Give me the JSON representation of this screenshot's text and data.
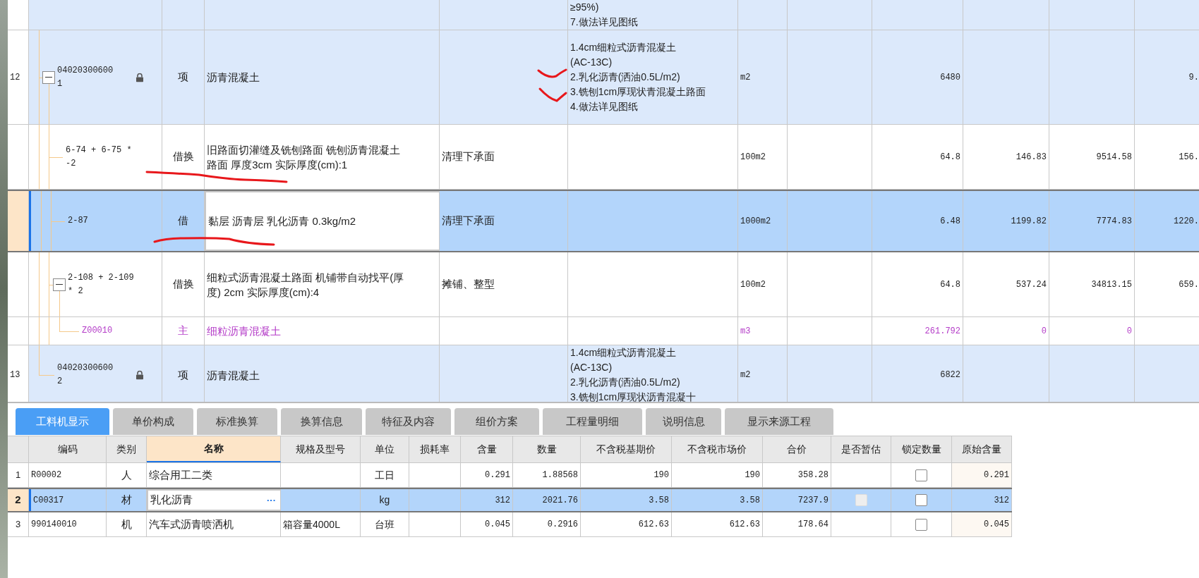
{
  "grid": {
    "rows": [
      {
        "kind": "item",
        "selected": false,
        "features": [
          "≥95%)",
          "7.做法详见图纸"
        ]
      },
      {
        "kind": "item",
        "selected": false,
        "number": "12",
        "code": "040203006001",
        "locked": true,
        "expanded": true,
        "type": "项",
        "name": "沥青混凝土",
        "features": [
          "1.4cm细粒式沥青混凝土",
          "(AC-13C)",
          "2.乳化沥青(洒油0.5L/m2)",
          "3.铣刨1cm厚现状青混凝土路面",
          "4.做法详见图纸"
        ],
        "unit": "m2",
        "column_9": "6480",
        "column_12": "9.",
        "children": [
          {
            "kind": "sub",
            "selected": false,
            "code": "6-74 + 6-75 * -2",
            "type": "借换",
            "name": "旧路面切灌缝及铣刨路面 铣刨沥青混凝土路面 厚度3cm  实际厚度(cm):1",
            "column_5": "清理下承面",
            "unit": "100m2",
            "column_9": "64.8",
            "column_10": "146.83",
            "column_11": "9514.58",
            "column_12": "156."
          },
          {
            "kind": "sub",
            "selected": true,
            "code": "2-87",
            "type": "借",
            "name": "黏层 沥青层 乳化沥青 0.3kg/m2",
            "column_5": "清理下承面",
            "unit": "1000m2",
            "column_9": "6.48",
            "column_10": "1199.82",
            "column_11": "7774.83",
            "column_12": "1220."
          },
          {
            "kind": "sub",
            "selected": false,
            "code": "2-108 + 2-109 * 2",
            "expanded": true,
            "type": "借换",
            "name": "细粒式沥青混凝土路面 机铺带自动找平(厚度) 2cm  实际厚度(cm):4",
            "column_5": "摊铺、整型",
            "unit": "100m2",
            "column_9": "64.8",
            "column_10": "537.24",
            "column_11": "34813.15",
            "column_12": "659.",
            "children": [
              {
                "kind": "main",
                "selected": false,
                "code": "Z00010",
                "type": "主",
                "name": "细粒沥青混凝土",
                "unit": "m3",
                "column_9": "261.792",
                "column_10": "0",
                "column_11": "0"
              }
            ]
          }
        ]
      },
      {
        "kind": "item",
        "selected": false,
        "number": "13",
        "code": "040203006002",
        "locked": true,
        "type": "项",
        "name": "沥青混凝土",
        "features": [
          "1.4cm细粒式沥青混凝土",
          "(AC-13C)",
          "2.乳化沥青(洒油0.5L/m2)",
          "3.铣刨1cm厚现状沥青混凝十"
        ],
        "unit": "m2",
        "column_9": "6822"
      }
    ]
  },
  "tabs": [
    {
      "label": "工料机显示",
      "selected": true
    },
    {
      "label": "单价构成",
      "selected": false
    },
    {
      "label": "标准换算",
      "selected": false
    },
    {
      "label": "换算信息",
      "selected": false
    },
    {
      "label": "特征及内容",
      "selected": false
    },
    {
      "label": "组价方案",
      "selected": false
    },
    {
      "label": "工程量明细",
      "selected": false
    },
    {
      "label": "说明信息",
      "selected": false
    },
    {
      "label": "显示来源工程",
      "selected": false
    }
  ],
  "resources": {
    "columns": [
      {
        "label": "编码",
        "selected": false
      },
      {
        "label": "类别",
        "selected": false
      },
      {
        "label": "名称",
        "selected": true
      },
      {
        "label": "规格及型号",
        "selected": false
      },
      {
        "label": "单位",
        "selected": false
      },
      {
        "label": "损耗率",
        "selected": false
      },
      {
        "label": "含量",
        "selected": false
      },
      {
        "label": "数量",
        "selected": false
      },
      {
        "label": "不含税基期价",
        "selected": false
      },
      {
        "label": "不含税市场价",
        "selected": false
      },
      {
        "label": "合价",
        "selected": false
      },
      {
        "label": "是否暂估",
        "selected": false
      },
      {
        "label": "锁定数量",
        "selected": false
      },
      {
        "label": "原始含量",
        "selected": false
      }
    ],
    "rows": [
      {
        "number": "1",
        "selected": false,
        "code": "R00002",
        "type": "人",
        "name": "综合用工二类",
        "unit": "工日",
        "content": "0.291",
        "quantity": "1.88568",
        "base_price": "190",
        "market_price": "190",
        "total": "358.28",
        "lock_quantity": false,
        "original_content": "0.291"
      },
      {
        "number": "2",
        "selected": true,
        "code": "C00317",
        "type": "材",
        "name": "乳化沥青",
        "more_button": "···",
        "unit": "kg",
        "content": "312",
        "quantity": "2021.76",
        "base_price": "3.58",
        "market_price": "3.58",
        "total": "7237.9",
        "provisional": {
          "checked": false,
          "disabled": true
        },
        "lock_quantity": false,
        "original_content": "312"
      },
      {
        "number": "3",
        "selected": false,
        "code": "990140010",
        "type": "机",
        "name": "汽车式沥青喷洒机",
        "spec": "箱容量4000L",
        "unit": "台班",
        "content": "0.045",
        "quantity": "0.2916",
        "base_price": "612.63",
        "market_price": "612.63",
        "total": "178.64",
        "lock_quantity": false,
        "original_content": "0.045"
      }
    ]
  }
}
